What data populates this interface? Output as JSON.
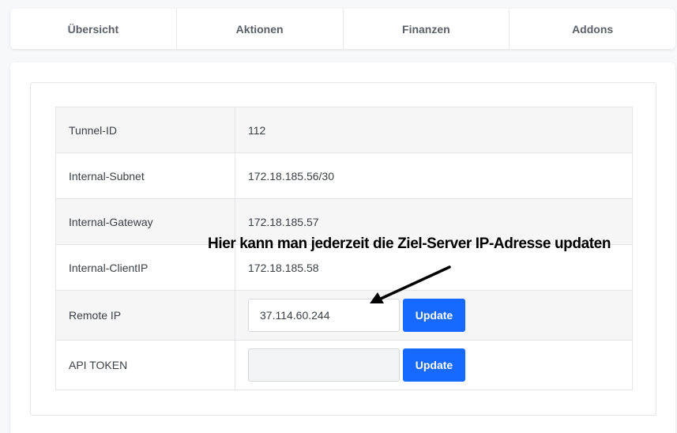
{
  "tabs": [
    {
      "label": "Übersicht"
    },
    {
      "label": "Aktionen"
    },
    {
      "label": "Finanzen"
    },
    {
      "label": "Addons"
    }
  ],
  "table": {
    "rows": [
      {
        "label": "Tunnel-ID",
        "value": "112"
      },
      {
        "label": "Internal-Subnet",
        "value": "172.18.185.56/30"
      },
      {
        "label": "Internal-Gateway",
        "value": "172.18.185.57"
      },
      {
        "label": "Internal-ClientIP",
        "value": "172.18.185.58"
      }
    ],
    "remote_ip": {
      "label": "Remote IP",
      "value": "37.114.60.244",
      "button": "Update"
    },
    "api_token": {
      "label": "API TOKEN",
      "value": "",
      "button": "Update"
    }
  },
  "annotation": {
    "text": "Hier kann man jederzeit die Ziel-Server IP-Adresse updaten"
  },
  "colors": {
    "accent": "#1769ff",
    "stripe": "#f6f6f7"
  }
}
